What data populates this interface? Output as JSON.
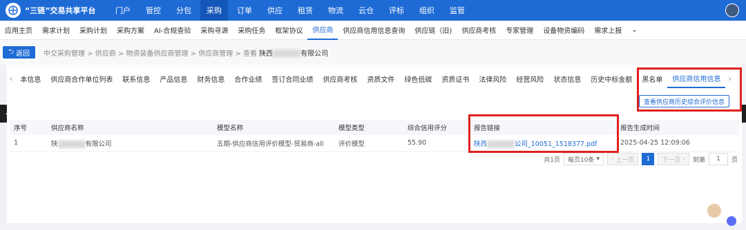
{
  "topbar": {
    "brand": "“三链”交易共享平台",
    "nav": [
      "门户",
      "管控",
      "分包",
      "采购",
      "订单",
      "供应",
      "租赁",
      "物流",
      "云仓",
      "评标",
      "组织",
      "监管"
    ],
    "active_nav": "采购"
  },
  "subbar": {
    "items": [
      "应用主页",
      "需求计划",
      "采购计划",
      "采购方案",
      "AI-合规查验",
      "采购寻源",
      "采购任务",
      "框架协议",
      "供应商",
      "供应商信用信息查询",
      "供应链（旧)",
      "供应商考核",
      "专家管理",
      "设备物资编码",
      "需求上报"
    ],
    "active": "供应商",
    "more_glyph": "⌄"
  },
  "breadcrumb": {
    "back_label": "返回",
    "path": "中交采购管理 > 供应商 > 物资装备供应商管理 > 供应商管理 > 查看",
    "current_prefix": "陕西",
    "current_suffix": "有限公司"
  },
  "tabs": {
    "items": [
      "本信息",
      "供应商合作单位列表",
      "联系信息",
      "产品信息",
      "财务信息",
      "合作业绩",
      "签订合同业绩",
      "供应商考核",
      "资质文件",
      "绿色低碳",
      "资质证书",
      "法律风险",
      "经营风险",
      "状态信息",
      "历史中标金额",
      "黑名单",
      "供应商信用信息"
    ],
    "active": "供应商信用信息",
    "left_chevron": "‹",
    "right_chevron": "›"
  },
  "history_button": "查看供应商历史综合评价信息",
  "table": {
    "headers": [
      "序号",
      "供应商名称",
      "模型名称",
      "模型类型",
      "综合信用评分",
      "报告链接",
      "报告生成时间"
    ],
    "rows": [
      {
        "index": "1",
        "name_prefix": "陕",
        "name_suffix": "有限公司",
        "model_name": "五期-供应商信用评价模型-贸易商-all",
        "model_type": "评价模型",
        "score": "55.90",
        "link_prefix": "陕西",
        "link_suffix": "公司_10051_1518377.pdf",
        "time": "2025-04-25 12:09:06"
      }
    ]
  },
  "pager": {
    "total": "共1页",
    "page_size": "每页10条",
    "prev": "上一页",
    "current": "1",
    "next": "下一页",
    "goto_label": "到第",
    "goto_value": "1",
    "page_suffix": "页"
  },
  "arrows": {
    "left": "‹",
    "right": "›"
  },
  "colors": {
    "primary": "#1e6bd6",
    "highlight": "#e02020"
  }
}
